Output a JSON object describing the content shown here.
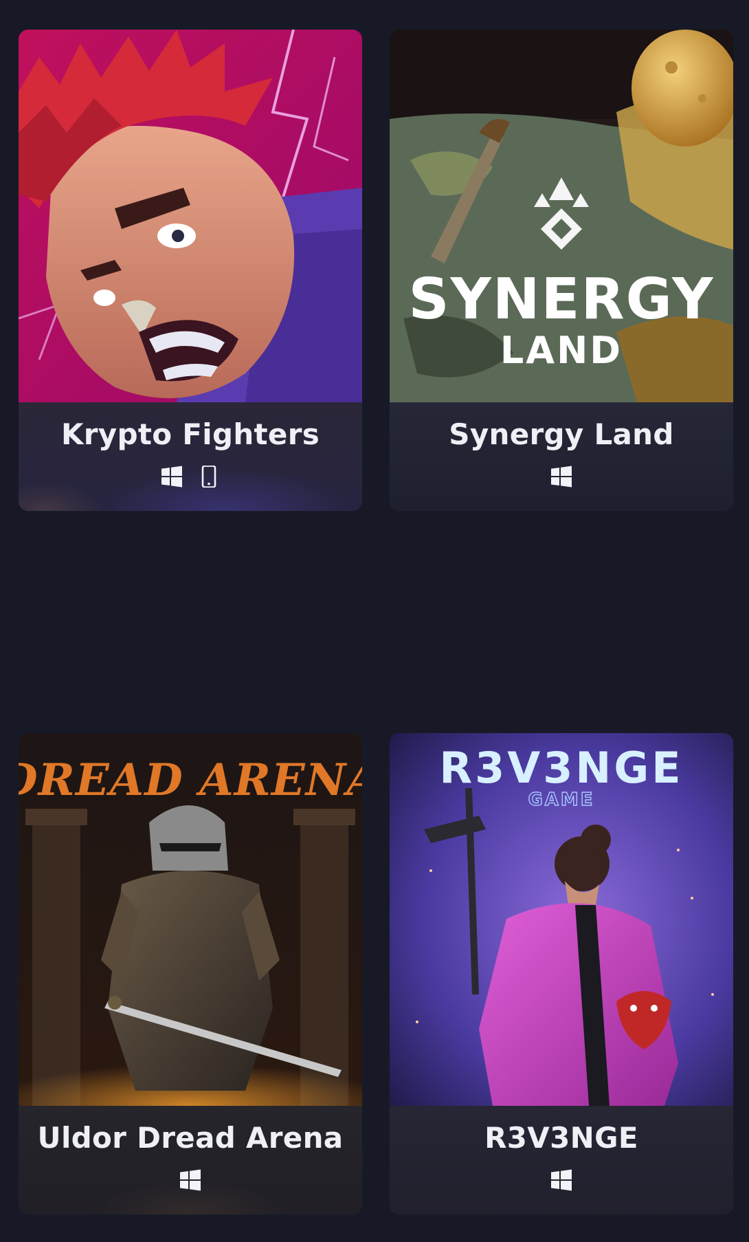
{
  "games": [
    {
      "title": "Krypto Fighters",
      "platforms": [
        "windows-icon",
        "mobile-icon"
      ],
      "artwork": "krypto-fighters-artwork"
    },
    {
      "title": "Synergy Land",
      "artwork_logo_line1": "SYNERGY",
      "artwork_logo_line2": "LAND",
      "platforms": [
        "windows-icon"
      ],
      "artwork": "synergy-land-artwork"
    },
    {
      "title": "Uldor Dread Arena",
      "artwork_logo": "DREAD ARENA",
      "platforms": [
        "windows-icon"
      ],
      "artwork": "dread-arena-artwork"
    },
    {
      "title": "R3V3NGE",
      "artwork_logo_line1": "R3V3NGE",
      "artwork_logo_line2": "GAME",
      "platforms": [
        "windows-icon"
      ],
      "artwork": "r3v3nge-artwork"
    }
  ],
  "colors": {
    "page_background": "#171a26",
    "card_background": "#1f2130",
    "title_text": "#eef0f6"
  }
}
